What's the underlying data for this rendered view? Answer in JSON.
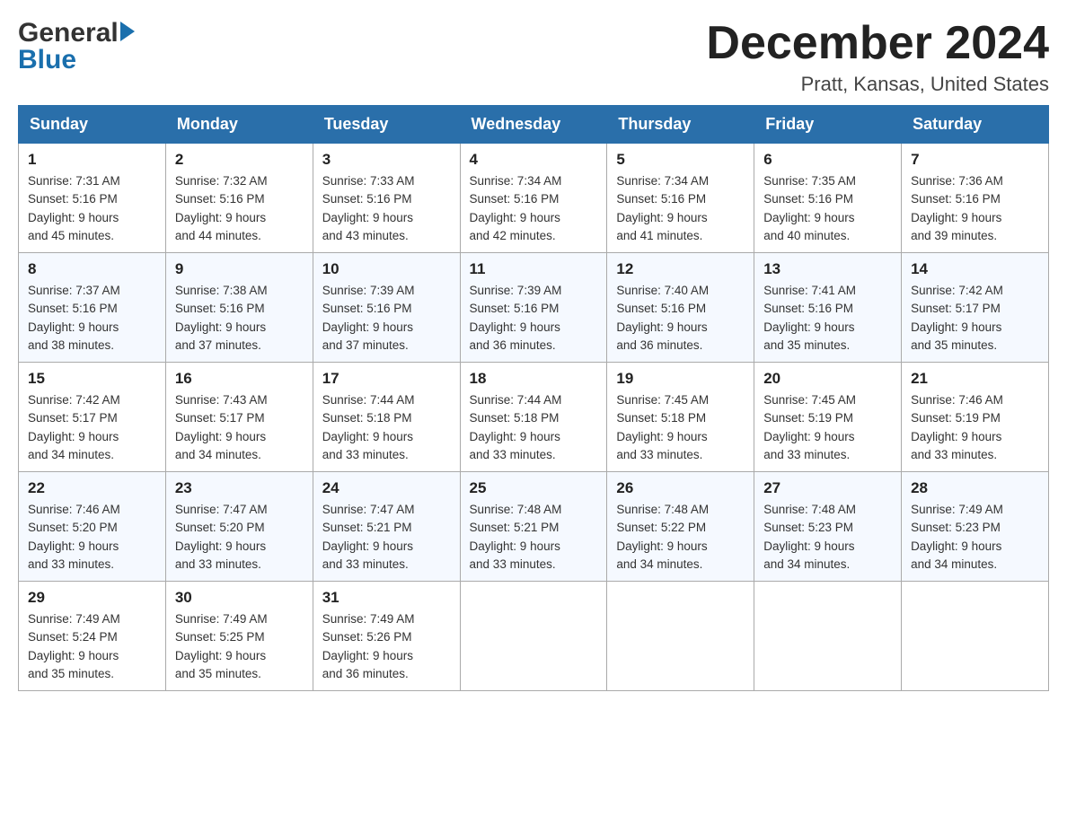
{
  "header": {
    "logo": {
      "part1": "General",
      "arrow": "▶",
      "part2": "Blue"
    },
    "title": "December 2024",
    "location": "Pratt, Kansas, United States"
  },
  "weekdays": [
    "Sunday",
    "Monday",
    "Tuesday",
    "Wednesday",
    "Thursday",
    "Friday",
    "Saturday"
  ],
  "weeks": [
    [
      {
        "day": "1",
        "sunrise": "7:31 AM",
        "sunset": "5:16 PM",
        "daylight": "9 hours and 45 minutes."
      },
      {
        "day": "2",
        "sunrise": "7:32 AM",
        "sunset": "5:16 PM",
        "daylight": "9 hours and 44 minutes."
      },
      {
        "day": "3",
        "sunrise": "7:33 AM",
        "sunset": "5:16 PM",
        "daylight": "9 hours and 43 minutes."
      },
      {
        "day": "4",
        "sunrise": "7:34 AM",
        "sunset": "5:16 PM",
        "daylight": "9 hours and 42 minutes."
      },
      {
        "day": "5",
        "sunrise": "7:34 AM",
        "sunset": "5:16 PM",
        "daylight": "9 hours and 41 minutes."
      },
      {
        "day": "6",
        "sunrise": "7:35 AM",
        "sunset": "5:16 PM",
        "daylight": "9 hours and 40 minutes."
      },
      {
        "day": "7",
        "sunrise": "7:36 AM",
        "sunset": "5:16 PM",
        "daylight": "9 hours and 39 minutes."
      }
    ],
    [
      {
        "day": "8",
        "sunrise": "7:37 AM",
        "sunset": "5:16 PM",
        "daylight": "9 hours and 38 minutes."
      },
      {
        "day": "9",
        "sunrise": "7:38 AM",
        "sunset": "5:16 PM",
        "daylight": "9 hours and 37 minutes."
      },
      {
        "day": "10",
        "sunrise": "7:39 AM",
        "sunset": "5:16 PM",
        "daylight": "9 hours and 37 minutes."
      },
      {
        "day": "11",
        "sunrise": "7:39 AM",
        "sunset": "5:16 PM",
        "daylight": "9 hours and 36 minutes."
      },
      {
        "day": "12",
        "sunrise": "7:40 AM",
        "sunset": "5:16 PM",
        "daylight": "9 hours and 36 minutes."
      },
      {
        "day": "13",
        "sunrise": "7:41 AM",
        "sunset": "5:16 PM",
        "daylight": "9 hours and 35 minutes."
      },
      {
        "day": "14",
        "sunrise": "7:42 AM",
        "sunset": "5:17 PM",
        "daylight": "9 hours and 35 minutes."
      }
    ],
    [
      {
        "day": "15",
        "sunrise": "7:42 AM",
        "sunset": "5:17 PM",
        "daylight": "9 hours and 34 minutes."
      },
      {
        "day": "16",
        "sunrise": "7:43 AM",
        "sunset": "5:17 PM",
        "daylight": "9 hours and 34 minutes."
      },
      {
        "day": "17",
        "sunrise": "7:44 AM",
        "sunset": "5:18 PM",
        "daylight": "9 hours and 33 minutes."
      },
      {
        "day": "18",
        "sunrise": "7:44 AM",
        "sunset": "5:18 PM",
        "daylight": "9 hours and 33 minutes."
      },
      {
        "day": "19",
        "sunrise": "7:45 AM",
        "sunset": "5:18 PM",
        "daylight": "9 hours and 33 minutes."
      },
      {
        "day": "20",
        "sunrise": "7:45 AM",
        "sunset": "5:19 PM",
        "daylight": "9 hours and 33 minutes."
      },
      {
        "day": "21",
        "sunrise": "7:46 AM",
        "sunset": "5:19 PM",
        "daylight": "9 hours and 33 minutes."
      }
    ],
    [
      {
        "day": "22",
        "sunrise": "7:46 AM",
        "sunset": "5:20 PM",
        "daylight": "9 hours and 33 minutes."
      },
      {
        "day": "23",
        "sunrise": "7:47 AM",
        "sunset": "5:20 PM",
        "daylight": "9 hours and 33 minutes."
      },
      {
        "day": "24",
        "sunrise": "7:47 AM",
        "sunset": "5:21 PM",
        "daylight": "9 hours and 33 minutes."
      },
      {
        "day": "25",
        "sunrise": "7:48 AM",
        "sunset": "5:21 PM",
        "daylight": "9 hours and 33 minutes."
      },
      {
        "day": "26",
        "sunrise": "7:48 AM",
        "sunset": "5:22 PM",
        "daylight": "9 hours and 34 minutes."
      },
      {
        "day": "27",
        "sunrise": "7:48 AM",
        "sunset": "5:23 PM",
        "daylight": "9 hours and 34 minutes."
      },
      {
        "day": "28",
        "sunrise": "7:49 AM",
        "sunset": "5:23 PM",
        "daylight": "9 hours and 34 minutes."
      }
    ],
    [
      {
        "day": "29",
        "sunrise": "7:49 AM",
        "sunset": "5:24 PM",
        "daylight": "9 hours and 35 minutes."
      },
      {
        "day": "30",
        "sunrise": "7:49 AM",
        "sunset": "5:25 PM",
        "daylight": "9 hours and 35 minutes."
      },
      {
        "day": "31",
        "sunrise": "7:49 AM",
        "sunset": "5:26 PM",
        "daylight": "9 hours and 36 minutes."
      },
      null,
      null,
      null,
      null
    ]
  ],
  "labels": {
    "sunrise": "Sunrise:",
    "sunset": "Sunset:",
    "daylight": "Daylight:"
  }
}
